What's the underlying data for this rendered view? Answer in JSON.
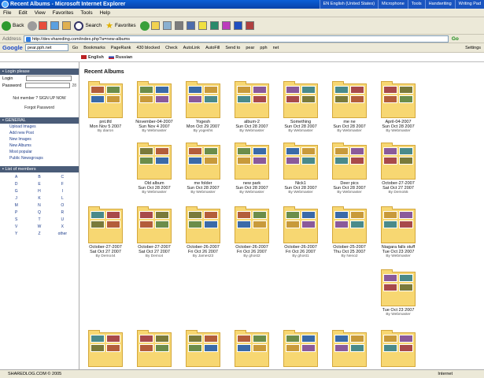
{
  "window": {
    "title": "Recent Albums - Microsoft Internet Explorer"
  },
  "tray": [
    "EN English (United States)",
    "Microphone",
    "Tools",
    "Handwriting",
    "Writing Pad"
  ],
  "menu": [
    "File",
    "Edit",
    "View",
    "Favorites",
    "Tools",
    "Help"
  ],
  "toolbar": {
    "back": "Back",
    "search": "Search",
    "favorites": "Favorites"
  },
  "address": {
    "label": "Address",
    "url": "http://dev.vhareding.com/index.php?a=new-albums",
    "go": "Go"
  },
  "google": {
    "logo": "Google",
    "query": "pear.pph.net",
    "items": [
      "Go",
      "Bookmarks",
      "PageRank",
      "430 blocked",
      "Check",
      "AutoLink",
      "AutoFill",
      "Send to",
      "pear",
      "pph",
      "net",
      "Settings"
    ]
  },
  "lang": {
    "english": "English",
    "russian": "Russian"
  },
  "sidebar": {
    "login_head": "Login please",
    "login_label": "Login",
    "password_label": "Password",
    "password_suffix": "28",
    "signup": "Not member ? SIGN UP NOW",
    "forgot": "Forgot Password",
    "general_head": "GENERAL",
    "links": [
      "Upload Images",
      "Add new Post",
      "New Images",
      "New Albums",
      "Most popular",
      "Public Newsgroups"
    ],
    "members_head": "List of members",
    "letters": [
      "A",
      "B",
      "C",
      "D",
      "E",
      "F",
      "G",
      "H",
      "I",
      "J",
      "K",
      "L",
      "M",
      "N",
      "O",
      "P",
      "Q",
      "R",
      "S",
      "T",
      "U",
      "V",
      "W",
      "X",
      "Y",
      "Z",
      "other"
    ]
  },
  "main": {
    "title": "Recent Albums",
    "albums": [
      {
        "title": "pnt.tfd",
        "date": "Mon Nov 5 2007",
        "by": "By diaron"
      },
      {
        "title": "November-04-2007",
        "date": "Sun Nov 4 2007",
        "by": "By Webmaster"
      },
      {
        "title": "Yogesh",
        "date": "Mon Oct 29 2007",
        "by": "By yogeshs"
      },
      {
        "title": "album-2",
        "date": "Sun Oct 28 2007",
        "by": "By Webmaster"
      },
      {
        "title": "Something",
        "date": "Sun Oct 28 2007",
        "by": "By Webmaster"
      },
      {
        "title": "me ne",
        "date": "Sun Oct 28 2007",
        "by": "By Webmaster"
      },
      {
        "title": "April-04-2007",
        "date": "Sun Oct 28 2007",
        "by": "By Webmaster"
      },
      {
        "title": "Old album",
        "date": "Sun Oct 28 2007",
        "by": "By Webmaster"
      },
      {
        "title": "me folder",
        "date": "Sun Oct 28 2007",
        "by": "By Webmaster"
      },
      {
        "title": "new park",
        "date": "Sun Oct 28 2007",
        "by": "By Webmaster"
      },
      {
        "title": "Nick1",
        "date": "Sun Oct 28 2007",
        "by": "By Webmaster"
      },
      {
        "title": "Deer pics",
        "date": "Sun Oct 28 2007",
        "by": "By Webmaster"
      },
      {
        "title": "October-27-2007",
        "date": "Sat Oct 27 2007",
        "by": "By Demo55"
      },
      {
        "title": "October-27-2007",
        "date": "Sat Oct 27 2007",
        "by": "By Demo44"
      },
      {
        "title": "October-27-2007",
        "date": "Sat Oct 27 2007",
        "by": "By Demo4"
      },
      {
        "title": "October-26-2007",
        "date": "Fri Oct 26 2007",
        "by": "By James23"
      },
      {
        "title": "October-26-2007",
        "date": "Fri Oct 26 2007",
        "by": "By ghost2"
      },
      {
        "title": "October-26-2007",
        "date": "Fri Oct 26 2007",
        "by": "By ghost1"
      },
      {
        "title": "October-25-2007",
        "date": "Thu Oct 25 2007",
        "by": "By Neno2"
      },
      {
        "title": "Niagara falls stuff",
        "date": "Tue Oct 23 2007",
        "by": "By Webmaster"
      },
      {
        "title": "",
        "date": "Tue Oct 23 2007",
        "by": "By Webmaster"
      },
      {
        "title": "",
        "date": "",
        "by": ""
      },
      {
        "title": "",
        "date": "",
        "by": ""
      },
      {
        "title": "",
        "date": "",
        "by": ""
      },
      {
        "title": "",
        "date": "",
        "by": ""
      },
      {
        "title": "",
        "date": "",
        "by": ""
      },
      {
        "title": "",
        "date": "",
        "by": ""
      },
      {
        "title": "",
        "date": "",
        "by": ""
      }
    ]
  },
  "status": {
    "left": "SHAREDLOG.COM © 2005",
    "zone": "Internet"
  }
}
